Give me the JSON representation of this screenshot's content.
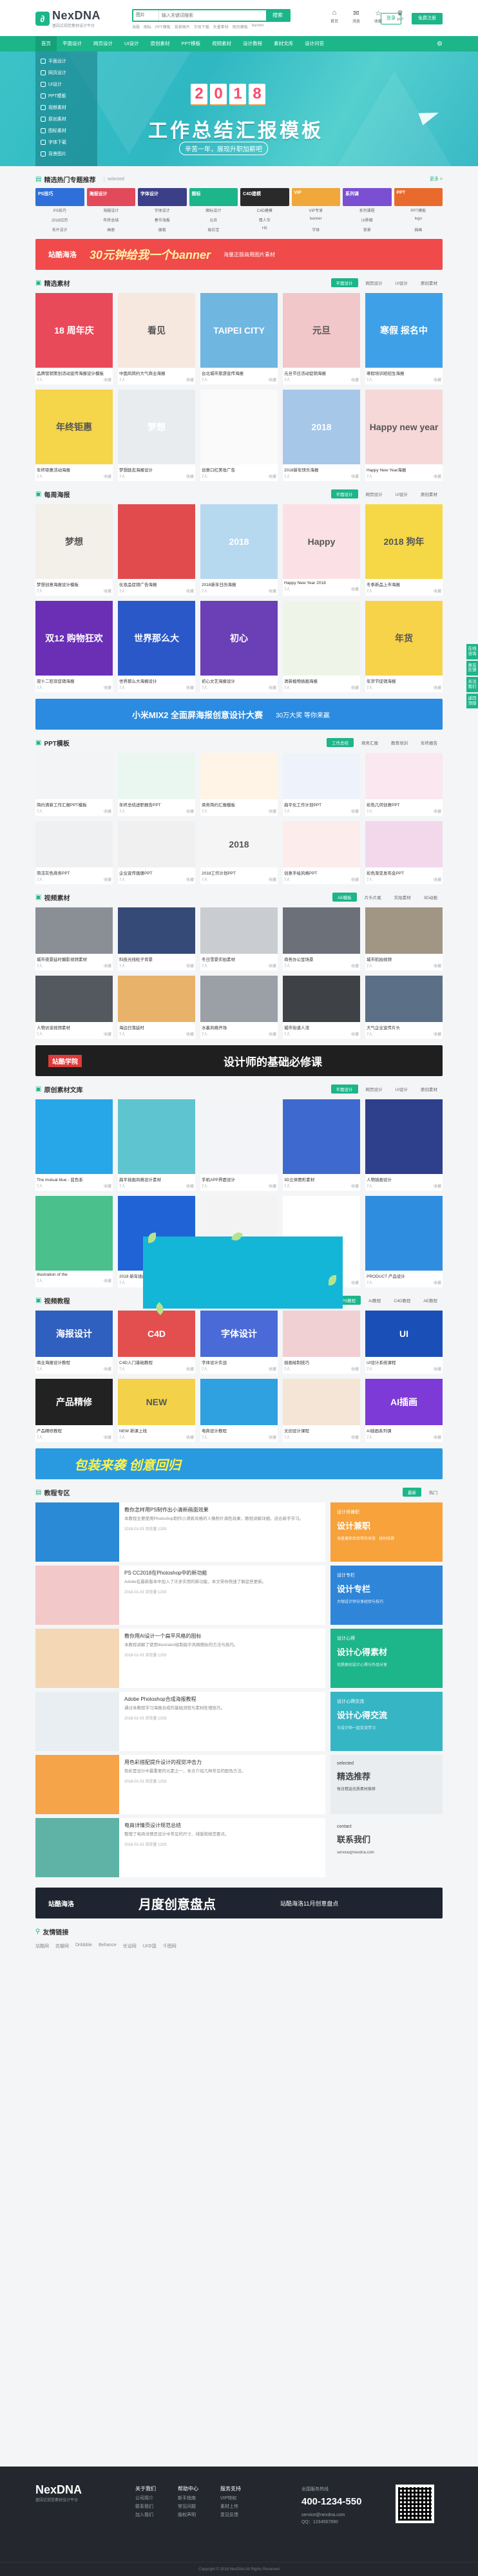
{
  "brand": {
    "name": "NexDNA",
    "tagline": "基因式视觉素材设计平台"
  },
  "header": {
    "search_category": "图片",
    "search_placeholder": "输入关键词搜索",
    "search_button": "搜索",
    "hot_words": [
      "海报",
      "图标",
      "PPT模板",
      "背景图片",
      "字体下载",
      "矢量素材",
      "网页模板",
      "banner"
    ],
    "icons": [
      {
        "glyph": "⌂",
        "label": "首页"
      },
      {
        "glyph": "✉",
        "label": "消息"
      },
      {
        "glyph": "☆",
        "label": "收藏"
      },
      {
        "glyph": "♛",
        "label": "VIP"
      }
    ],
    "login": "登录",
    "register": "免费注册"
  },
  "nav": {
    "items": [
      "首页",
      "平面设计",
      "网页设计",
      "UI设计",
      "原创素材",
      "PPT模板",
      "视频素材",
      "设计教程",
      "素材文库",
      "设计问答"
    ],
    "extra_glyph": "⚙"
  },
  "banner": {
    "year_digits": [
      "2",
      "0",
      "1",
      "8"
    ],
    "title": "工作总结汇报模板",
    "subtitle": "辛苦一年，展现升职加薪吧",
    "left_menu": [
      "平面设计",
      "网页设计",
      "UI设计",
      "PPT模板",
      "视频素材",
      "原创素材",
      "图标素材",
      "字体下载",
      "背景图片"
    ]
  },
  "hot": {
    "title": "精选热门专题推荐",
    "sub": "selected",
    "more": "更多 >",
    "cards": [
      {
        "label": "PS技巧",
        "bg": "#2f6fd9"
      },
      {
        "label": "海报设计",
        "bg": "#e04a5a"
      },
      {
        "label": "字体设计",
        "bg": "#3a3f88"
      },
      {
        "label": "图标",
        "bg": "#1db58a"
      },
      {
        "label": "C4D建模",
        "bg": "#2a2a2a"
      },
      {
        "label": "VIP",
        "bg": "#f0a83a"
      },
      {
        "label": "系列课",
        "bg": "#7b4fd1"
      },
      {
        "label": "PPT",
        "bg": "#e86b2d"
      }
    ],
    "card_labels": [
      "PS技巧",
      "海报设计",
      "字体设计",
      "图标设计",
      "C4D建模",
      "VIP专享",
      "系列课程",
      "PPT模板"
    ],
    "text_row1": [
      "2018日历",
      "年终总结",
      "春节海报",
      "元旦",
      "情人节",
      "banner",
      "UI界面",
      "logo"
    ],
    "text_row2": [
      "名片设计",
      "画册",
      "展板",
      "易拉宝",
      "H5",
      "字体",
      "背景",
      "插画"
    ]
  },
  "ad1": {
    "brand": "站酷海洛",
    "text": "30元钟给我一个banner",
    "sub": "海量正版商用图片素材",
    "bg": "#f04a4a"
  },
  "section1": {
    "title": "精选素材",
    "tabs": [
      "平面设计",
      "网页设计",
      "UI设计",
      "原创素材"
    ],
    "items": [
      {
        "cap": "品牌营销策划活动宣传海报设计模板",
        "a": "7人",
        "b": "收藏",
        "bg": "#e94a5a",
        "t": "18 周年庆"
      },
      {
        "cap": "中国风简约大气商业海报",
        "a": "7人",
        "b": "收藏",
        "bg": "#f6e8df",
        "t": "看见"
      },
      {
        "cap": "台北城市旅游宣传海报",
        "a": "7人",
        "b": "收藏",
        "bg": "#6fb6e0",
        "t": "TAIPEI CITY"
      },
      {
        "cap": "元旦节日活动促销海报",
        "a": "7人",
        "b": "收藏",
        "bg": "#f2c7c9",
        "t": "元旦"
      },
      {
        "cap": "寒假培训班招生海报",
        "a": "7人",
        "b": "收藏",
        "bg": "#3ea1e8",
        "t": "寒假 报名中"
      },
      {
        "cap": "年终钜惠活动海报",
        "a": "7人",
        "b": "收藏",
        "bg": "#f5d54a",
        "t": "年终钜惠"
      },
      {
        "cap": "梦想励志海报设计",
        "a": "7人",
        "b": "收藏",
        "bg": "#e8ecef",
        "t": "梦想"
      },
      {
        "cap": "创意口红美妆广告",
        "a": "7人",
        "b": "收藏",
        "bg": "#fafafa",
        "t": ""
      },
      {
        "cap": "2018新年快乐海报",
        "a": "7人",
        "b": "收藏",
        "bg": "#a7c7e9",
        "t": "2018"
      },
      {
        "cap": "Happy New Year海报",
        "a": "7人",
        "b": "收藏",
        "bg": "#f6d8d8",
        "t": "Happy new year"
      }
    ]
  },
  "section2": {
    "title": "每周海报",
    "tabs": [
      "平面设计",
      "网页设计",
      "UI设计",
      "原创素材"
    ],
    "items": [
      {
        "cap": "梦想创意海报设计模板",
        "a": "7人",
        "b": "收藏",
        "bg": "#f3efe9",
        "t": "梦想"
      },
      {
        "cap": "化妆品促销广告海报",
        "a": "7人",
        "b": "收藏",
        "bg": "#e24b4e",
        "t": ""
      },
      {
        "cap": "2018新年日历海报",
        "a": "7人",
        "b": "收藏",
        "bg": "#b7d9f0",
        "t": "2018"
      },
      {
        "cap": "Happy New Year 2018",
        "a": "7人",
        "b": "收藏",
        "bg": "#fbe1e5",
        "t": "Happy"
      },
      {
        "cap": "冬季新品上市海报",
        "a": "7人",
        "b": "收藏",
        "bg": "#f6d847",
        "t": "2018 狗年"
      },
      {
        "cap": "双十二狂欢促销海报",
        "a": "7人",
        "b": "收藏",
        "bg": "#6b2fb6",
        "t": "双12 购物狂欢"
      },
      {
        "cap": "世界那么大海报设计",
        "a": "7人",
        "b": "收藏",
        "bg": "#2a58c9",
        "t": "世界那么大"
      },
      {
        "cap": "初心文艺海报设计",
        "a": "7人",
        "b": "收藏",
        "bg": "#6b3fb5",
        "t": "初心"
      },
      {
        "cap": "清新植物插画海报",
        "a": "7人",
        "b": "收藏",
        "bg": "#eef5e8",
        "t": ""
      },
      {
        "cap": "年货节促销海报",
        "a": "7人",
        "b": "收藏",
        "bg": "#f7d34a",
        "t": "年货"
      }
    ]
  },
  "ad2": {
    "text": "小米MIX2 全面屏海报创意设计大赛",
    "sub": "30万大奖 等你来赢",
    "bg": "#2a8be0"
  },
  "section3": {
    "title": "PPT模板",
    "tabs": [
      "工作总结",
      "商务汇报",
      "教育培训",
      "年终报告"
    ],
    "items": [
      {
        "cap": "简约清新工作汇报PPT模板",
        "a": "7人",
        "b": "收藏",
        "bg": "#f2f4f6",
        "t": ""
      },
      {
        "cap": "年终总结述职报告PPT",
        "a": "7人",
        "b": "收藏",
        "bg": "#eaf6f0",
        "t": ""
      },
      {
        "cap": "商务简约汇报模板",
        "a": "7人",
        "b": "收藏",
        "bg": "#fff4e5",
        "t": ""
      },
      {
        "cap": "扁平化工作计划PPT",
        "a": "7人",
        "b": "收藏",
        "bg": "#eef3fb",
        "t": ""
      },
      {
        "cap": "彩色几何创意PPT",
        "a": "7人",
        "b": "收藏",
        "bg": "#fbe7f0",
        "t": ""
      },
      {
        "cap": "简洁灰色商务PPT",
        "a": "7人",
        "b": "收藏",
        "bg": "#eef0f2",
        "t": ""
      },
      {
        "cap": "企业宣传画册PPT",
        "a": "7人",
        "b": "收藏",
        "bg": "#f0f0f0",
        "t": ""
      },
      {
        "cap": "2018工作计划PPT",
        "a": "7人",
        "b": "收藏",
        "bg": "#f5f5f5",
        "t": "2018"
      },
      {
        "cap": "创意手绘风格PPT",
        "a": "7人",
        "b": "收藏",
        "bg": "#fdecec",
        "t": ""
      },
      {
        "cap": "彩色渐变发布会PPT",
        "a": "7人",
        "b": "收藏",
        "bg": "#f3d8ec",
        "t": ""
      }
    ]
  },
  "section4": {
    "title": "视频素材",
    "tabs": [
      "AE模板",
      "片头片尾",
      "实拍素材",
      "3D动画"
    ],
    "items": [
      {
        "cap": "城市夜景延时摄影视频素材",
        "a": "7人",
        "b": "收藏",
        "bg": "#8a8f96",
        "t": ""
      },
      {
        "cap": "科技光线粒子背景",
        "a": "7人",
        "b": "收藏",
        "bg": "#364a78",
        "t": ""
      },
      {
        "cap": "冬日雪景实拍素材",
        "a": "7人",
        "b": "收藏",
        "bg": "#c9ccd1",
        "t": ""
      },
      {
        "cap": "商务办公室场景",
        "a": "7人",
        "b": "收藏",
        "bg": "#6c7079",
        "t": ""
      },
      {
        "cap": "城市航拍视频",
        "a": "7人",
        "b": "收藏",
        "bg": "#a19584",
        "t": ""
      },
      {
        "cap": "人物访谈视频素材",
        "a": "7人",
        "b": "收藏",
        "bg": "#54595f",
        "t": ""
      },
      {
        "cap": "海边日落延时",
        "a": "7人",
        "b": "收藏",
        "bg": "#e8b26a",
        "t": ""
      },
      {
        "cap": "水墨风格开场",
        "a": "7人",
        "b": "收藏",
        "bg": "#9aa0a6",
        "t": ""
      },
      {
        "cap": "城市街道人流",
        "a": "7人",
        "b": "收藏",
        "bg": "#3e4247",
        "t": ""
      },
      {
        "cap": "大气企业宣传片头",
        "a": "7人",
        "b": "收藏",
        "bg": "#5b6f86",
        "t": ""
      }
    ]
  },
  "ad3": {
    "brand": "站酷学院",
    "text": "设计师的基础必修课",
    "bg": "#1f1f1f"
  },
  "section5": {
    "title": "原创素材文库",
    "tabs": [
      "平面设计",
      "网页设计",
      "UI设计",
      "原创素材"
    ],
    "items": [
      {
        "cap": "The mutual blue - 蓝色系",
        "a": "7人",
        "b": "收藏",
        "bg": "#28a7e8",
        "t": ""
      },
      {
        "cap": "扁平插画风格设计素材",
        "a": "7人",
        "b": "收藏",
        "bg": "#5ec4d0",
        "t": ""
      },
      {
        "cap": "手机APP界面设计",
        "a": "7人",
        "b": "收藏",
        "bg": "#f2f4f8",
        "t": ""
      },
      {
        "cap": "3D立体图形素材",
        "a": "7人",
        "b": "收藏",
        "bg": "#3e6ad0",
        "t": ""
      },
      {
        "cap": "人物插画设计",
        "a": "7人",
        "b": "收藏",
        "bg": "#2e3f8c",
        "t": ""
      },
      {
        "cap": "Illustration of the",
        "a": "7人",
        "b": "收藏",
        "bg": "#4ac08d",
        "t": ""
      },
      {
        "cap": "2018 新年插画素材",
        "a": "7人",
        "b": "收藏",
        "bg": "#1f63d6",
        "t": ""
      },
      {
        "cap": "红色卡通形象",
        "a": "7人",
        "b": "收藏",
        "bg": "#f3f3f3",
        "t": ""
      },
      {
        "cap": "UI 图标设计合集",
        "a": "7人",
        "b": "收藏",
        "bg": "#ffffff",
        "t": ""
      },
      {
        "cap": "PRODUCT 产品设计",
        "a": "7人",
        "b": "收藏",
        "bg": "#2f8de0",
        "t": ""
      }
    ]
  },
  "section6": {
    "title": "视频教程",
    "tabs": [
      "PS教程",
      "AI教程",
      "C4D教程",
      "AE教程"
    ],
    "items": [
      {
        "cap": "商业海报设计教程",
        "a": "7人",
        "b": "收藏",
        "bg": "#2f5fbf",
        "t": "海报设计"
      },
      {
        "cap": "C4D入门基础教程",
        "a": "7人",
        "b": "收藏",
        "bg": "#e34f4f",
        "t": "C4D"
      },
      {
        "cap": "字体设计实战",
        "a": "7人",
        "b": "收藏",
        "bg": "#4a6ad8",
        "t": "字体设计"
      },
      {
        "cap": "插画绘制技巧",
        "a": "7人",
        "b": "收藏",
        "bg": "#f1d0d4",
        "t": ""
      },
      {
        "cap": "UI设计系统课程",
        "a": "7人",
        "b": "收藏",
        "bg": "#1a4fb8",
        "t": "UI"
      },
      {
        "cap": "产品精修教程",
        "a": "7人",
        "b": "收藏",
        "bg": "#222",
        "t": "产品精修"
      },
      {
        "cap": "NEW 新课上线",
        "a": "7人",
        "b": "收藏",
        "bg": "#f3d24a",
        "t": "NEW"
      },
      {
        "cap": "电商设计教程",
        "a": "7人",
        "b": "收藏",
        "bg": "#2fa0e0",
        "t": ""
      },
      {
        "cap": "文创设计课程",
        "a": "7人",
        "b": "收藏",
        "bg": "#f5e5d6",
        "t": ""
      },
      {
        "cap": "AI插画系列课",
        "a": "7人",
        "b": "收藏",
        "bg": "#7d3ad6",
        "t": "AI插画"
      }
    ]
  },
  "ad4": {
    "text": "包装来袭 创意回归",
    "bg": "#2a9ae0"
  },
  "tutorials": {
    "title": "教程专区",
    "tabs": [
      "最新",
      "热门"
    ],
    "rows": [
      {
        "title": "教你怎样用PS制作出小清新画面效果",
        "desc": "本教程主要使用Photoshop制作小清新风格的人像照片调色效果，教程讲解详细，适合新手学习。",
        "meta": "2018-01-03  浏览量 1203",
        "bg": "#2a8ad6"
      },
      {
        "title": "PS CC2018在Photoshop中的新功能",
        "desc": "Adobe在最新版本中加入了许多实用的新功能，本文带你快速了解这些更新。",
        "meta": "2018-01-03  浏览量 1203",
        "bg": "#f2c8c8"
      },
      {
        "title": "教你用AI设计一个扁平风格的图标",
        "desc": "本教程讲解了使用Illustrator绘制扁平风格图标的方法与技巧。",
        "meta": "2018-01-03  浏览量 1203",
        "bg": "#f4d7b5"
      },
      {
        "title": "Adobe Photoshop合成海报教程",
        "desc": "通过本教程学习海报合成的基础流程与素材处理技巧。",
        "meta": "2018-01-03  浏览量 1203",
        "bg": "#e8eef2"
      },
      {
        "title": "用色彩搭配提升设计的视觉冲击力",
        "desc": "色彩是设计中最重要的元素之一，本文介绍几种常见的配色方法。",
        "meta": "2018-01-03  浏览量 1203",
        "bg": "#f6a44a"
      },
      {
        "title": "电商详情页设计规范总结",
        "desc": "整理了电商详情页设计中常见的尺寸、排版和规范要点。",
        "meta": "2018-01-03  浏览量 1203",
        "bg": "#5fb3a6"
      }
    ],
    "side": [
      {
        "title": "设计师兼职",
        "big": "设计兼职",
        "lines": "海量兼职项目等你来接 · 按时结算",
        "bg": "#f7a23a"
      },
      {
        "title": "设计专栏",
        "big": "设计专栏",
        "lines": "大咖设计师分享经验与技巧",
        "bg": "#2f86d8"
      },
      {
        "title": "设计心得",
        "big": "设计心得素材",
        "lines": "优质原创设计心得与作品分享",
        "bg": "#1db58a"
      },
      {
        "title": "设计心得交流",
        "big": "设计心得交流",
        "lines": "与设计师一起交流学习",
        "bg": "#36b5c4"
      },
      {
        "title": "selected",
        "big": "精选推荐",
        "lines": "每日精选优质素材推荐",
        "bg": "#e9edf0"
      },
      {
        "title": "contact",
        "big": "联系我们",
        "lines": "service@nexdna.com",
        "bg": "#f4f5f7"
      }
    ]
  },
  "ad5": {
    "brand": "站酷海洛",
    "text": "月度创意盘点",
    "sub": "站酷海洛11月创意盘点",
    "bg": "#1e2530"
  },
  "links": {
    "title": "友情链接",
    "items": [
      "站酷网",
      "花瓣网",
      "Dribbble",
      "Behance",
      "优设网",
      "UI中国",
      "千图网"
    ]
  },
  "sidebar": [
    "在线咨询",
    "意见反馈",
    "关注我们",
    "返回顶部"
  ],
  "footer": {
    "tagline": "基因式视觉素材设计平台",
    "cols": [
      {
        "h": "关于我们",
        "items": [
          "公司简介",
          "联系我们",
          "加入我们"
        ]
      },
      {
        "h": "帮助中心",
        "items": [
          "新手指南",
          "常见问题",
          "版权声明"
        ]
      },
      {
        "h": "服务支持",
        "items": [
          "VIP特权",
          "素材上传",
          "意见反馈"
        ]
      }
    ],
    "hotline_label": "全国服务热线",
    "phone": "400-1234-550",
    "mail": "service@nexdna.com",
    "qq": "QQ：1234567890",
    "copyright": "Copyright © 2018 NexDNA All Rights Reserved"
  }
}
